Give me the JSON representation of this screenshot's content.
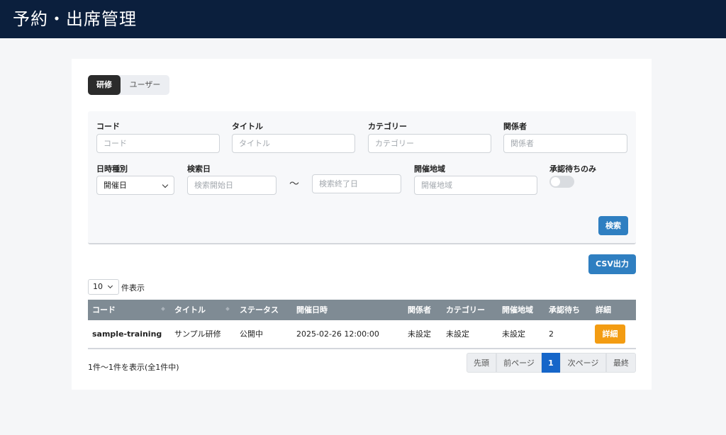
{
  "header": {
    "title": "予約・出席管理"
  },
  "tabs": [
    {
      "label": "研修",
      "active": true
    },
    {
      "label": "ユーザー",
      "active": false
    }
  ],
  "search": {
    "code": {
      "label": "コード",
      "placeholder": "コード",
      "value": ""
    },
    "title": {
      "label": "タイトル",
      "placeholder": "タイトル",
      "value": ""
    },
    "category": {
      "label": "カテゴリー",
      "placeholder": "カテゴリー",
      "value": ""
    },
    "related": {
      "label": "関係者",
      "placeholder": "関係者",
      "value": ""
    },
    "date_type": {
      "label": "日時種別",
      "value": "開催日"
    },
    "search_date": {
      "label": "検索日",
      "start_placeholder": "検索開始日",
      "end_placeholder": "検索終了日",
      "separator": "〜"
    },
    "region": {
      "label": "開催地域",
      "placeholder": "開催地域",
      "value": ""
    },
    "pending_only": {
      "label": "承認待ちのみ",
      "checked": false
    },
    "search_button": "検索"
  },
  "csv_button": "CSV出力",
  "page_length": {
    "value": "10",
    "label": "件表示"
  },
  "table": {
    "columns": [
      "コード",
      "タイトル",
      "ステータス",
      "開催日時",
      "関係者",
      "カテゴリー",
      "開催地域",
      "承認待ち",
      "詳細"
    ],
    "rows": [
      {
        "code": "sample-training",
        "title": "サンプル研修",
        "status": "公開中",
        "datetime": "2025-02-26 12:00:00",
        "related": "未設定",
        "category": "未設定",
        "region": "未設定",
        "pending": "2",
        "detail": "詳細"
      }
    ]
  },
  "info": "1件〜1件を表示(全1件中)",
  "pagination": {
    "first": "先頭",
    "prev": "前ページ",
    "current": "1",
    "next": "次ページ",
    "last": "最終"
  },
  "colors": {
    "header": "#0b1f3d",
    "primary": "#2f7fc1",
    "detail": "#f39c12",
    "table_header": "#7f8b94",
    "page_active": "#1666c9"
  }
}
